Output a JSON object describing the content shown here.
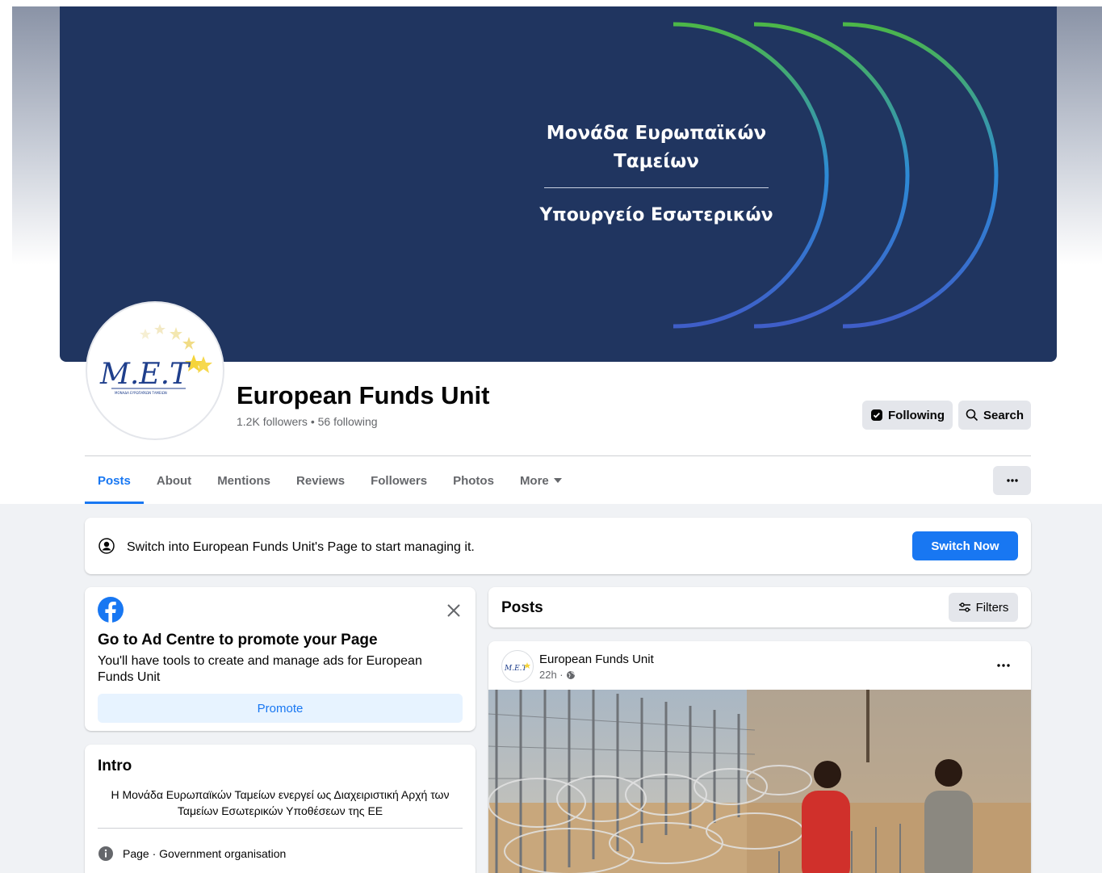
{
  "cover": {
    "title": "Μονάδα Ευρωπαϊκών Ταμείων",
    "subtitle": "Υπουργείο Εσωτερικών"
  },
  "profile": {
    "logo_text": "M.E.T",
    "logo_caption": "ΜΟΝΑΔΑ ΕΥΡΩΠΑΪΚΩΝ ΤΑΜΕΙΩΝ",
    "name": "European Funds Unit",
    "stats": "1.2K followers • 56 following",
    "following_label": "Following",
    "search_label": "Search"
  },
  "tabs": [
    {
      "label": "Posts",
      "active": true
    },
    {
      "label": "About"
    },
    {
      "label": "Mentions"
    },
    {
      "label": "Reviews"
    },
    {
      "label": "Followers"
    },
    {
      "label": "Photos"
    },
    {
      "label": "More"
    }
  ],
  "switch_banner": {
    "text": "Switch into European Funds Unit's Page to start managing it.",
    "button": "Switch Now"
  },
  "promo": {
    "title": "Go to Ad Centre to promote your Page",
    "description": "You'll have tools to create and manage ads for European Funds Unit",
    "button": "Promote"
  },
  "intro": {
    "title": "Intro",
    "bio": "Η Μονάδα Ευρωπαϊκών Ταμείων ενεργεί ως Διαχειριστική Αρχή των Ταμείων Εσωτερικών Υποθέσεων της ΕΕ",
    "category": "Page · Government organisation"
  },
  "posts_header": {
    "title": "Posts",
    "filters_label": "Filters"
  },
  "post": {
    "author": "European Funds Unit",
    "time": "22h ·"
  },
  "colors": {
    "accent": "#1877f2",
    "cover_bg": "#203560"
  }
}
